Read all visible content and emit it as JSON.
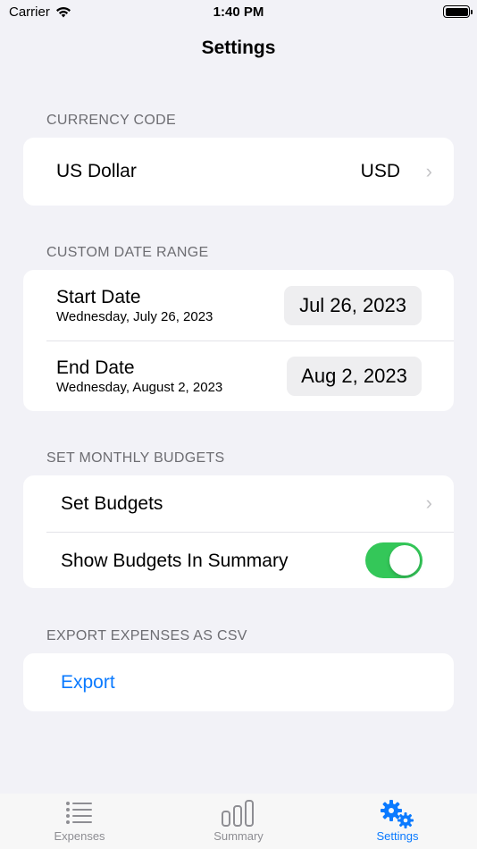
{
  "status_bar": {
    "carrier": "Carrier",
    "time": "1:40 PM"
  },
  "nav": {
    "title": "Settings"
  },
  "currency": {
    "header": "CURRENCY CODE",
    "name": "US Dollar",
    "code": "USD"
  },
  "date_range": {
    "header": "CUSTOM DATE RANGE",
    "start": {
      "label": "Start Date",
      "long": "Wednesday, July 26, 2023",
      "short": "Jul 26, 2023"
    },
    "end": {
      "label": "End Date",
      "long": "Wednesday, August 2, 2023",
      "short": "Aug 2, 2023"
    }
  },
  "budgets": {
    "header": "SET MONTHLY BUDGETS",
    "set_label": "Set Budgets",
    "show_label": "Show Budgets In Summary",
    "show_enabled": true
  },
  "export": {
    "header": "EXPORT EXPENSES AS CSV",
    "label": "Export"
  },
  "tabs": [
    {
      "label": "Expenses",
      "icon": "list-icon",
      "active": false
    },
    {
      "label": "Summary",
      "icon": "bar-chart-icon",
      "active": false
    },
    {
      "label": "Settings",
      "icon": "gears-icon",
      "active": true
    }
  ],
  "colors": {
    "accent": "#0a7aff",
    "toggle_on": "#34c759",
    "background": "#f2f2f7"
  }
}
